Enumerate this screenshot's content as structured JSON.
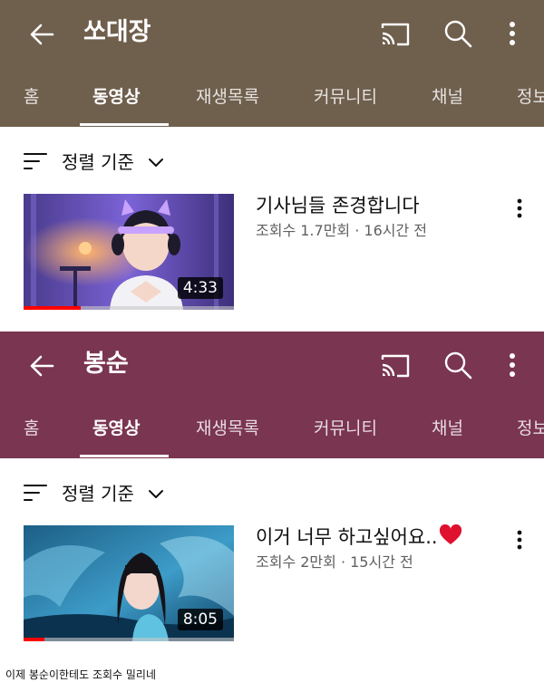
{
  "panels": [
    {
      "header_color": "#6f5f4d",
      "channel_name": "쏘대장",
      "tabs": [
        "홈",
        "동영상",
        "재생목록",
        "커뮤니티",
        "채널",
        "정보"
      ],
      "active_tab": "동영상",
      "sort_label": "정렬 기준",
      "video": {
        "title": "기사님들 존경합니다",
        "meta": "조회수 1.7만회 · 16시간 전",
        "duration": "4:33",
        "watched_fraction": 0.27
      }
    },
    {
      "header_color": "#7a3550",
      "channel_name": "봉순",
      "tabs": [
        "홈",
        "동영상",
        "재생목록",
        "커뮤니티",
        "채널",
        "정보"
      ],
      "active_tab": "동영상",
      "sort_label": "정렬 기준",
      "video": {
        "title": "이거 너무 하고싶어요..",
        "meta": "조회수 2만회 · 15시간 전",
        "duration": "8:05",
        "watched_fraction": 0.1
      }
    }
  ],
  "caption": "이제 봉순이한테도 조회수 밀리네",
  "icons": [
    "back-arrow-icon",
    "cast-icon",
    "search-icon",
    "more-vert-icon",
    "sort-icon",
    "chevron-down-icon",
    "heart-icon"
  ],
  "colors": {
    "progress": "#ff0000",
    "meta_text": "#606060",
    "heart": "#e0102f"
  }
}
